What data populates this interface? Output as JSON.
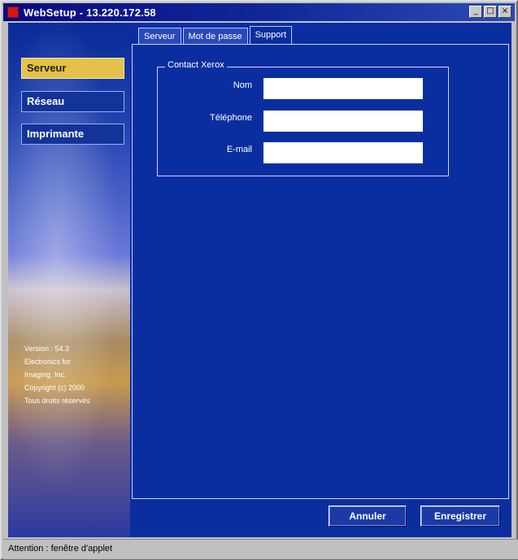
{
  "window": {
    "title": "WebSetup - 13.220.172.58",
    "controls": {
      "minimize": "_",
      "maximize": "□",
      "close": "×"
    }
  },
  "sidebar": {
    "items": [
      {
        "label": "Serveur",
        "active": true
      },
      {
        "label": "Réseau",
        "active": false
      },
      {
        "label": "Imprimante",
        "active": false
      }
    ],
    "info": {
      "line1": "Version : 54.3",
      "line2": "Electronics for",
      "line3": "Imaging, Inc.",
      "line4": "Copyright (c) 2000",
      "line5": "Tous droits réservés"
    }
  },
  "tabs": [
    {
      "label": "Serveur",
      "active": false
    },
    {
      "label": "Mot de passe",
      "active": false
    },
    {
      "label": "Support",
      "active": true
    }
  ],
  "contact": {
    "legend": "Contact Xerox",
    "name_label": "Nom",
    "name_value": "",
    "phone_label": "Téléphone",
    "phone_value": "",
    "email_label": "E-mail",
    "email_value": ""
  },
  "buttons": {
    "cancel": "Annuler",
    "save": "Enregistrer"
  },
  "status": {
    "text": "Attention : fenêtre d'applet"
  },
  "colors": {
    "accent": "#e2c24a",
    "panel": "#0a2ea0",
    "titlebar": "#0a0a80"
  }
}
